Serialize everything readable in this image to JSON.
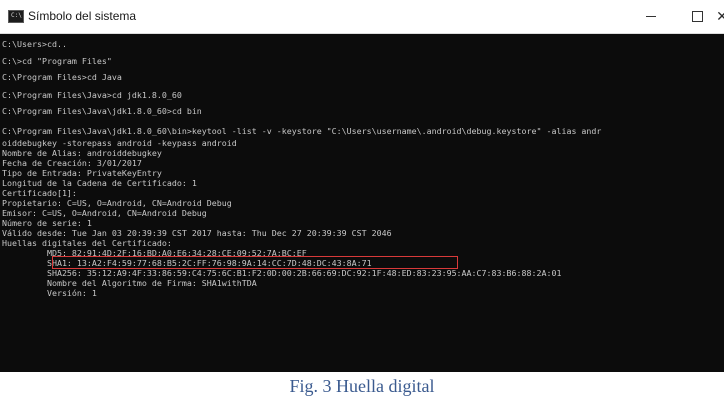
{
  "window": {
    "title": "Símbolo del sistema",
    "icon_name": "cmd-icon",
    "controls": {
      "minimize": "minimize-icon",
      "maximize": "maximize-icon",
      "close": "close-icon"
    }
  },
  "console": {
    "lines": [
      "C:\\Users>cd..",
      "",
      "C:\\>cd \"Program Files\"",
      "",
      "C:\\Program Files>cd Java",
      "",
      "C:\\Program Files\\Java>cd jdk1.8.0_60",
      "",
      "C:\\Program Files\\Java\\jdk1.8.0_60>cd bin",
      "",
      "C:\\Program Files\\Java\\jdk1.8.0_60\\bin>keytool -list -v -keystore \"C:\\Users\\username\\.android\\debug.keystore\" -alias andr",
      "oiddebugkey -storepass android -keypass android",
      "Nombre de Alias: androiddebugkey",
      "Fecha de Creación: 3/01/2017",
      "Tipo de Entrada: PrivateKeyEntry",
      "Longitud de la Cadena de Certificado: 1",
      "Certificado[1]:",
      "Propietario: C=US, O=Android, CN=Android Debug",
      "Emisor: C=US, O=Android, CN=Android Debug",
      "Número de serie: 1",
      "Válido desde: Tue Jan 03 20:39:39 CST 2017 hasta: Thu Dec 27 20:39:39 CST 2046",
      "Huellas digitales del Certificado:",
      "         MD5: 82:91:4D:2F:16:BD:A0:E6:34:28:CE:09:52:7A:BC:EF",
      "         SHA1: 13:A2:F4:59:77:68:B5:2C:FF:76:98:9A:14:CC:7D:48:DC:43:8A:71",
      "         SHA256: 35:12:A9:4F:33:86:59:C4:75:6C:B1:F2:0D:00:2B:66:69:DC:92:1F:48:ED:83:23:95:AA:C7:83:B6:88:2A:01",
      "         Nombre del Algoritmo de Firma: SHA1withTDA",
      "         Versión: 1"
    ]
  },
  "highlight_color": "#d93a3a",
  "caption": "Fig. 3 Huella digital"
}
